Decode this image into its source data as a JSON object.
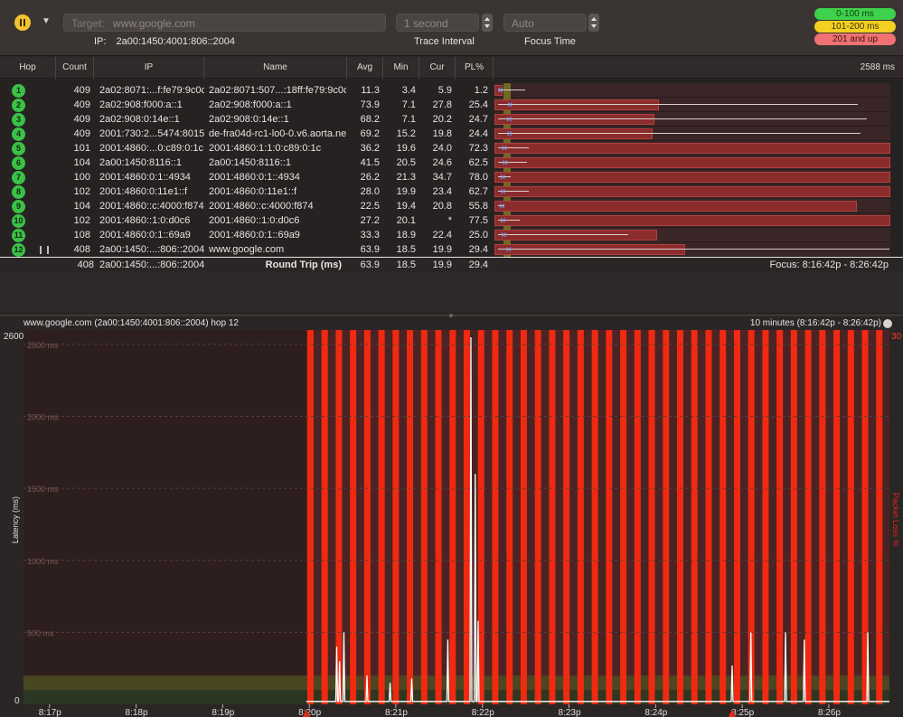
{
  "toolbar": {
    "target_label": "Target:",
    "target_value": "www.google.com",
    "ip_label": "IP:",
    "ip_value": "2a00:1450:4001:806::2004",
    "interval_value": "1 second",
    "interval_label": "Trace Interval",
    "focus_value": "Auto",
    "focus_label": "Focus Time",
    "legend": [
      {
        "label": "0-100 ms",
        "color": "#3ed14b",
        "text_color": "#103d12"
      },
      {
        "label": "101-200 ms",
        "color": "#f3d021",
        "text_color": "#3d3405"
      },
      {
        "label": "201 and up",
        "color": "#f07272",
        "text_color": "#3d1010"
      }
    ]
  },
  "table": {
    "headers": [
      "Hop",
      "Count",
      "IP",
      "Name",
      "Avg",
      "Min",
      "Cur",
      "PL%"
    ],
    "scale_label": "2588 ms",
    "rows": [
      {
        "hop": "1",
        "count": "409",
        "ip": "2a02:8071:...f:fe79:9c0c",
        "name": "2a02:8071:507...:18ff:fe79:9c0c",
        "avg": "11.3",
        "min": "3.4",
        "cur": "5.9",
        "pl": "1.2",
        "pl_frac": 0.012,
        "avg_ms": 11.3,
        "max_ms": 180
      },
      {
        "hop": "2",
        "count": "409",
        "ip": "2a02:908:f000:a::1",
        "name": "2a02:908:f000:a::1",
        "avg": "73.9",
        "min": "7.1",
        "cur": "27.8",
        "pl": "25.4",
        "pl_frac": 0.254,
        "avg_ms": 73.9,
        "max_ms": 2350
      },
      {
        "hop": "3",
        "count": "409",
        "ip": "2a02:908:0:14e::1",
        "name": "2a02:908:0:14e::1",
        "avg": "68.2",
        "min": "7.1",
        "cur": "20.2",
        "pl": "24.7",
        "pl_frac": 0.247,
        "avg_ms": 68.2,
        "max_ms": 2410
      },
      {
        "hop": "4",
        "count": "409",
        "ip": "2001:730:2...5474:8015",
        "name": "de-fra04d-rc1-lo0-0.v6.aorta.net",
        "avg": "69.2",
        "min": "15.2",
        "cur": "19.8",
        "pl": "24.4",
        "pl_frac": 0.244,
        "avg_ms": 69.2,
        "max_ms": 2370
      },
      {
        "hop": "5",
        "count": "101",
        "ip": "2001:4860:...0:c89:0:1c",
        "name": "2001:4860:1:1:0:c89:0:1c",
        "avg": "36.2",
        "min": "19.6",
        "cur": "24.0",
        "pl": "72.3",
        "pl_frac": 0.723,
        "avg_ms": 36.2,
        "max_ms": 200
      },
      {
        "hop": "6",
        "count": "104",
        "ip": "2a00:1450:8116::1",
        "name": "2a00:1450:8116::1",
        "avg": "41.5",
        "min": "20.5",
        "cur": "24.6",
        "pl": "62.5",
        "pl_frac": 0.625,
        "avg_ms": 41.5,
        "max_ms": 190
      },
      {
        "hop": "7",
        "count": "100",
        "ip": "2001:4860:0:1::4934",
        "name": "2001:4860:0:1::4934",
        "avg": "26.2",
        "min": "21.3",
        "cur": "34.7",
        "pl": "78.0",
        "pl_frac": 0.78,
        "avg_ms": 26.2,
        "max_ms": 80
      },
      {
        "hop": "8",
        "count": "102",
        "ip": "2001:4860:0:11e1::f",
        "name": "2001:4860:0:11e1::f",
        "avg": "28.0",
        "min": "19.9",
        "cur": "23.4",
        "pl": "62.7",
        "pl_frac": 0.627,
        "avg_ms": 28.0,
        "max_ms": 200
      },
      {
        "hop": "9",
        "count": "104",
        "ip": "2001:4860::c:4000:f874",
        "name": "2001:4860::c:4000:f874",
        "avg": "22.5",
        "min": "19.4",
        "cur": "20.8",
        "pl": "55.8",
        "pl_frac": 0.558,
        "avg_ms": 22.5,
        "max_ms": 40
      },
      {
        "hop": "10",
        "count": "102",
        "ip": "2001:4860::1:0:d0c6",
        "name": "2001:4860::1:0:d0c6",
        "avg": "27.2",
        "min": "20.1",
        "cur": "*",
        "pl": "77.5",
        "pl_frac": 0.775,
        "avg_ms": 27.2,
        "max_ms": 140
      },
      {
        "hop": "11",
        "count": "108",
        "ip": "2001:4860:0:1::69a9",
        "name": "2001:4860:0:1::69a9",
        "avg": "33.3",
        "min": "18.9",
        "cur": "22.4",
        "pl": "25.0",
        "pl_frac": 0.25,
        "avg_ms": 33.3,
        "max_ms": 850
      },
      {
        "hop": "12",
        "count": "408",
        "ip": "2a00:1450:...:806::2004",
        "name": "www.google.com",
        "avg": "63.9",
        "min": "18.5",
        "cur": "19.9",
        "pl": "29.4",
        "pl_frac": 0.294,
        "avg_ms": 63.9,
        "max_ms": 2560
      }
    ],
    "summary": {
      "count": "408",
      "ip": "2a00:1450:...:806::2004",
      "label": "Round Trip (ms)",
      "avg": "63.9",
      "min": "18.5",
      "cur": "19.9",
      "pl": "29.4",
      "focus": "Focus: 8:16:42p - 8:26:42p"
    }
  },
  "graph": {
    "title": "www.google.com (2a00:1450:4001:806::2004) hop 12",
    "range": "10 minutes (8:16:42p - 8:26:42p)",
    "y_label": "Latency (ms)",
    "y2_label": "Packet Loss %",
    "y_top": "2600",
    "y_bottom": "0",
    "y2_top": "30",
    "gridlines": [
      "2500 ms",
      "2000 ms",
      "1500 ms",
      "1000 ms",
      "500 ms"
    ],
    "x_ticks": [
      "8:17p",
      "8:18p",
      "8:19p",
      "8:20p",
      "8:21p",
      "8:22p",
      "8:23p",
      "8:24p",
      "8:25p",
      "8:26p"
    ]
  },
  "chart_data": {
    "type": "area",
    "y_label": "Latency (ms)",
    "y2_label": "Packet Loss %",
    "ylim": [
      0,
      2600
    ],
    "y2lim": [
      0,
      30
    ],
    "x_range": [
      "8:16:42p",
      "8:26:42p"
    ],
    "x_ticks": [
      "8:17p",
      "8:18p",
      "8:19p",
      "8:20p",
      "8:21p",
      "8:22p",
      "8:23p",
      "8:24p",
      "8:25p",
      "8:26p"
    ],
    "data_start": "8:19:58p",
    "latency_spikes_ms": [
      {
        "t": "8:20:19p",
        "v": 400
      },
      {
        "t": "8:20:21p",
        "v": 300
      },
      {
        "t": "8:20:24p",
        "v": 500
      },
      {
        "t": "8:20:40p",
        "v": 200
      },
      {
        "t": "8:20:56p",
        "v": 150
      },
      {
        "t": "8:21:11p",
        "v": 180
      },
      {
        "t": "8:21:36p",
        "v": 450
      },
      {
        "t": "8:21:52p",
        "v": 2550
      },
      {
        "t": "8:21:55p",
        "v": 1600
      },
      {
        "t": "8:21:57p",
        "v": 580
      },
      {
        "t": "8:24:53p",
        "v": 270
      },
      {
        "t": "8:25:06p",
        "v": 500
      },
      {
        "t": "8:25:30p",
        "v": 500
      },
      {
        "t": "8:25:43p",
        "v": 450
      },
      {
        "t": "8:26:27p",
        "v": 500
      }
    ],
    "baseline_ms": 20,
    "loss_event_count": 41
  }
}
